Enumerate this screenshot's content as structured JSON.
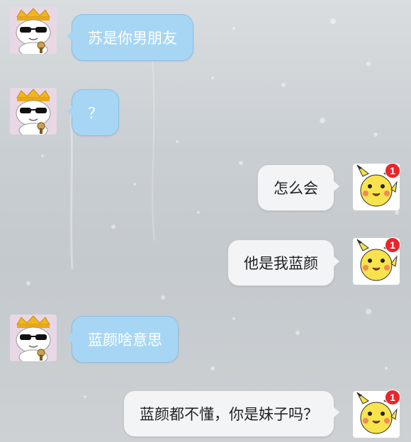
{
  "messages": [
    {
      "side": "left",
      "text": "苏是你男朋友"
    },
    {
      "side": "left",
      "text": "？"
    },
    {
      "side": "right",
      "text": "怎么会",
      "badge": "1"
    },
    {
      "side": "right",
      "text": "他是我蓝颜",
      "badge": "1"
    },
    {
      "side": "left",
      "text": "蓝颜啥意思"
    },
    {
      "side": "right",
      "text": "蓝颜都不懂，你是妹子吗？",
      "badge": "1"
    }
  ],
  "avatars": {
    "left": "crowned-cat-with-sunglasses-icon",
    "right": "pikachu-icon"
  },
  "colors": {
    "left_bubble": "#a7d6f5",
    "right_bubble": "#f3f4f5",
    "badge": "#e8252b"
  }
}
